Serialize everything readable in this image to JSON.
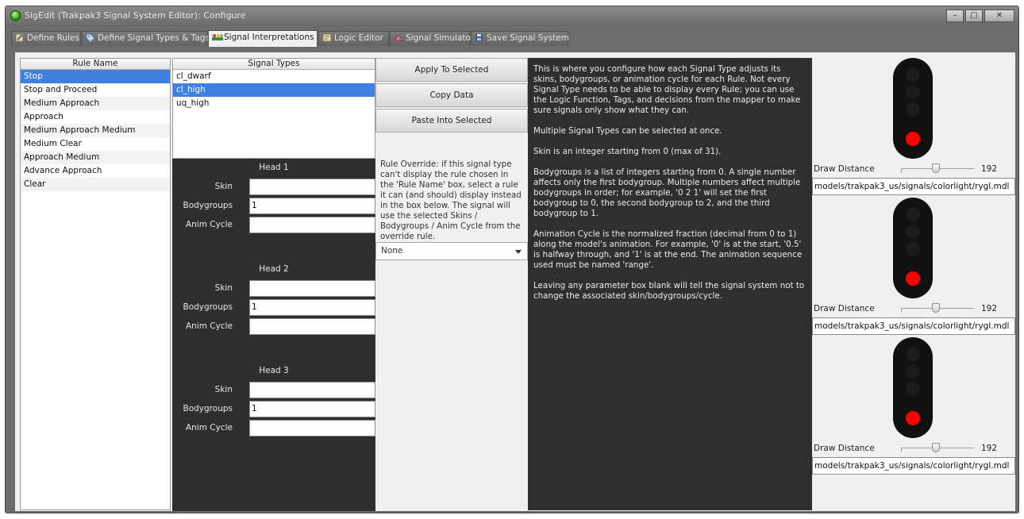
{
  "window": {
    "title": "SigEdit (Trakpak3 Signal System Editor): Configure"
  },
  "tabs": [
    {
      "label": "Define Rules",
      "icon": "edit-icon"
    },
    {
      "label": "Define Signal Types & Tags",
      "icon": "tag-icon"
    },
    {
      "label": "Signal Interpretations",
      "icon": "signal-icon",
      "active": true
    },
    {
      "label": "Logic Editor",
      "icon": "logic-icon"
    },
    {
      "label": "Signal Simulator",
      "icon": "simulator-icon"
    },
    {
      "label": "Save Signal System",
      "icon": "save-icon"
    }
  ],
  "rules": {
    "header": "Rule Name",
    "items": [
      "Stop",
      "Stop and Proceed",
      "Medium Approach",
      "Approach",
      "Medium Approach Medium",
      "Medium Clear",
      "Approach Medium",
      "Advance Approach",
      "Clear"
    ],
    "selected": "Stop"
  },
  "signal_types": {
    "header": "Signal Types",
    "items": [
      "cl_dwarf",
      "cl_high",
      "uq_high"
    ],
    "selected": "cl_high"
  },
  "heads": [
    {
      "title": "Head 1",
      "skin_label": "Skin",
      "skin": "",
      "bodygroups_label": "Bodygroups",
      "bodygroups": "1",
      "anim_label": "Anim Cycle",
      "anim": ""
    },
    {
      "title": "Head 2",
      "skin_label": "Skin",
      "skin": "",
      "bodygroups_label": "Bodygroups",
      "bodygroups": "1",
      "anim_label": "Anim Cycle",
      "anim": ""
    },
    {
      "title": "Head 3",
      "skin_label": "Skin",
      "skin": "",
      "bodygroups_label": "Bodygroups",
      "bodygroups": "1",
      "anim_label": "Anim Cycle",
      "anim": ""
    }
  ],
  "actions": {
    "apply": "Apply To Selected",
    "copy": "Copy Data",
    "paste": "Paste Into Selected"
  },
  "override": {
    "description": "Rule Override: if this signal type can't display the rule chosen in the 'Rule Name' box, select a rule it can (and should) display instead in the box below. The signal will use the selected Skins / Bodygroups / Anim Cycle from the override rule.",
    "value": "None"
  },
  "help": [
    "This is where you configure how each Signal Type adjusts its skins, bodygroups, or animation cycle for each Rule. Not every Signal Type needs to be able to display every Rule; you can use the Logic Function, Tags, and decisions from the mapper to make sure signals only show what they can.",
    "Multiple Signal Types can be selected at once.",
    "Skin is an integer starting from 0 (max of 31).",
    "Bodygroups is a list of integers starting from 0. A single number affects only the first bodygroup. Multiple numbers affect multiple bodygroups in order; for example, '0 2 1' will set the first bodygroup to 0, the second bodygroup to 2, and the third bodygroup to 1.",
    "Animation Cycle is the normalized fraction (decimal from 0 to 1) along the model's animation. For example, '0' is at the start, '0.5' is halfway through, and '1' is at the end. The animation sequence used must be named 'range'.",
    "Leaving any parameter box blank will tell the signal system not to change the associated skin/bodygroups/cycle."
  ],
  "previews": [
    {
      "draw_distance_label": "Draw Distance",
      "draw_distance": "192",
      "slider_fraction": 0.48,
      "model": "models/trakpak3_us/signals/colorlight/rygl.mdl",
      "lit_color": "#ff0000"
    },
    {
      "draw_distance_label": "Draw Distance",
      "draw_distance": "192",
      "slider_fraction": 0.48,
      "model": "models/trakpak3_us/signals/colorlight/rygl.mdl",
      "lit_color": "#ff0000"
    },
    {
      "draw_distance_label": "Draw Distance",
      "draw_distance": "192",
      "slider_fraction": 0.48,
      "model": "models/trakpak3_us/signals/colorlight/rygl.mdl",
      "lit_color": "#ff0000"
    }
  ]
}
